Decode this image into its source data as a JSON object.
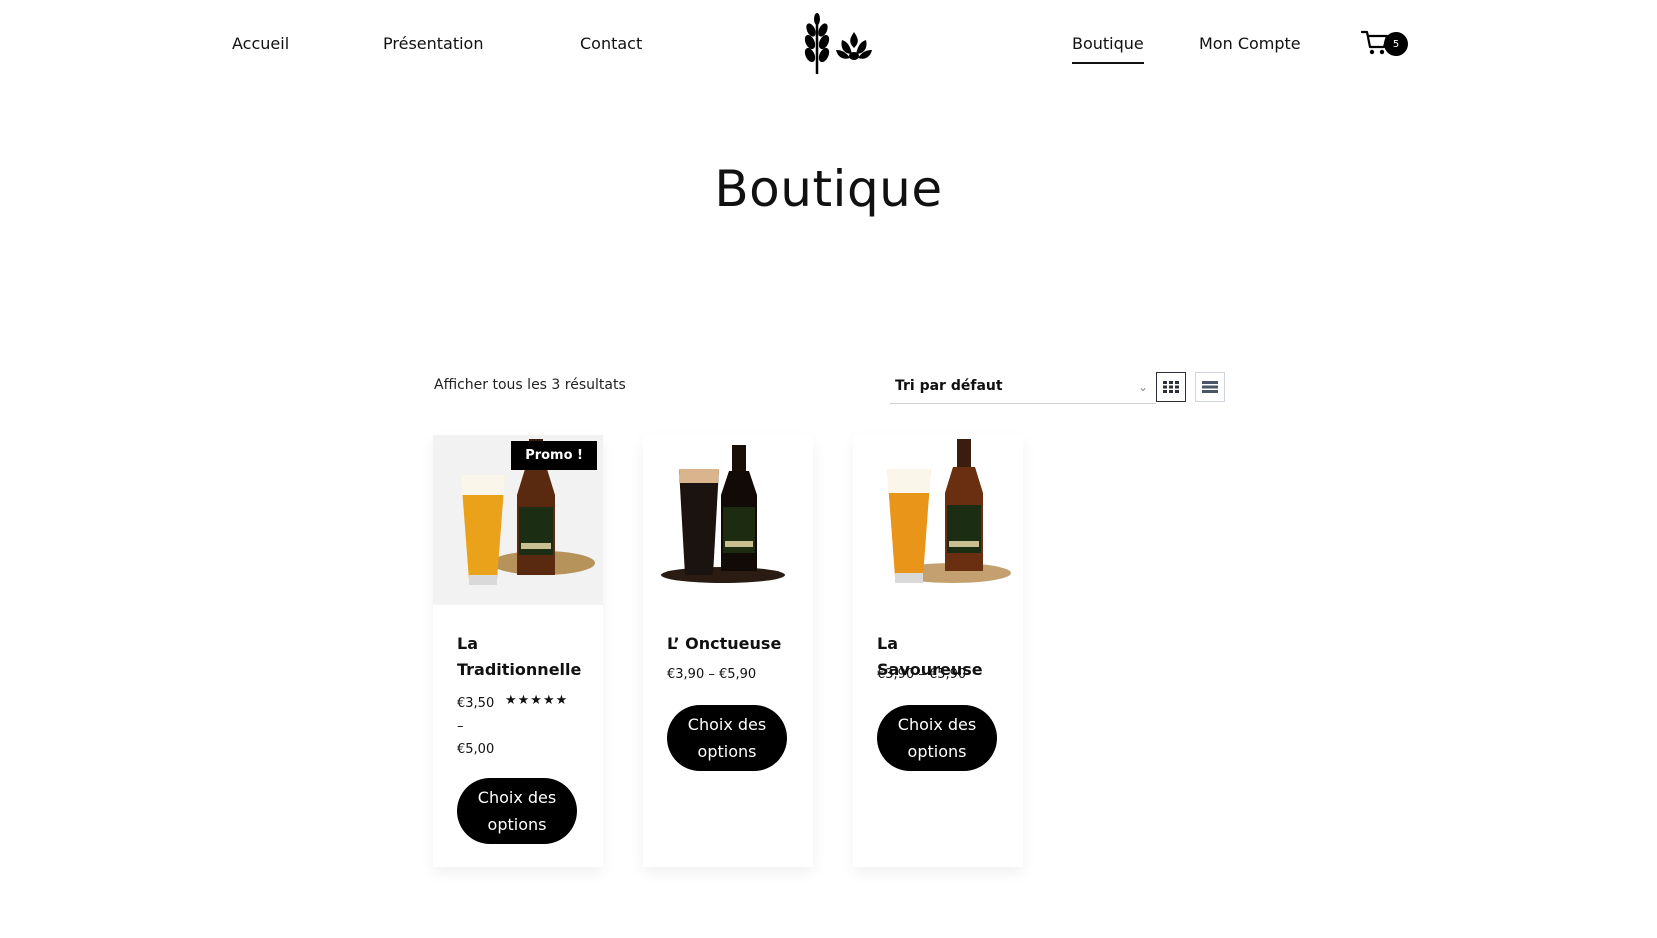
{
  "nav": {
    "home": "Accueil",
    "presentation": "Présentation",
    "contact": "Contact",
    "shop": "Boutique",
    "account": "Mon Compte",
    "cart_count": "5",
    "logo_icon": "wheat-hop-logo-icon",
    "cart_icon": "cart-icon"
  },
  "page": {
    "title": "Boutique"
  },
  "toolbar": {
    "result_count": "Afficher tous les 3 résultats",
    "sort_selected": "Tri par défaut",
    "grid_icon": "grid-view-icon",
    "list_icon": "list-view-icon"
  },
  "products": [
    {
      "name": "La Traditionnelle",
      "price_low": "€3,50",
      "price_sep": "–",
      "price_high": "€5,00",
      "badge": "Promo !",
      "rating": "★★★★★",
      "rating_value": 5,
      "button": "Choix des options",
      "beer_color": "#e9a219"
    },
    {
      "name": "L’ Onctueuse",
      "price": "€3,90 – €5,90",
      "button": "Choix des options",
      "beer_color": "#1a1310"
    },
    {
      "name": "La Savoureuse",
      "price": "€3,90 – €5,90",
      "button": "Choix des options",
      "beer_color": "#e9951a"
    }
  ],
  "colors": {
    "accent": "#000000",
    "background": "#ffffff"
  }
}
